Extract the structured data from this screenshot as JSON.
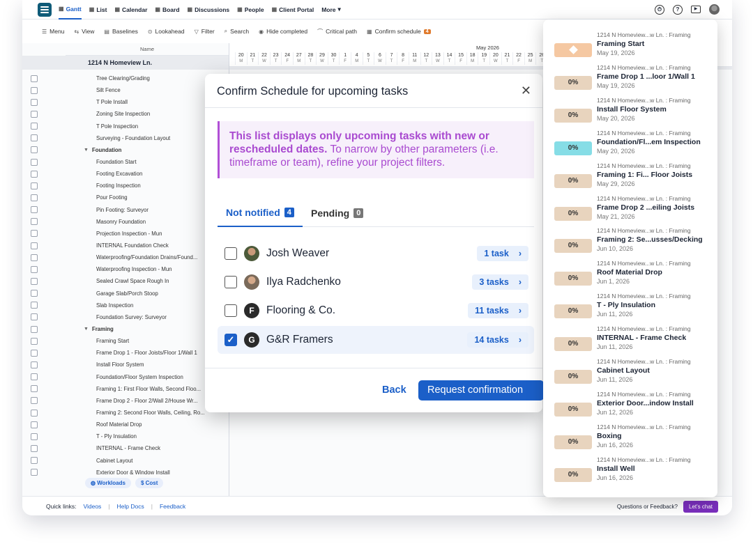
{
  "nav": {
    "items": [
      {
        "label": "Gantt",
        "icon": "gantt-icon",
        "active": true
      },
      {
        "label": "List",
        "icon": "list-icon"
      },
      {
        "label": "Calendar",
        "icon": "calendar-icon"
      },
      {
        "label": "Board",
        "icon": "board-icon"
      },
      {
        "label": "Discussions",
        "icon": "discussions-icon"
      },
      {
        "label": "People",
        "icon": "people-icon"
      },
      {
        "label": "Client Portal",
        "icon": "client-portal-icon"
      },
      {
        "label": "More"
      }
    ]
  },
  "toolbar": {
    "menu": "Menu",
    "view": "View",
    "baselines": "Baselines",
    "lookahead": "Lookahead",
    "filter": "Filter",
    "search": "Search",
    "hide_completed": "Hide completed",
    "critical_path": "Critical path",
    "confirm_schedule": "Confirm schedule",
    "confirm_count": "4"
  },
  "grid": {
    "name_header": "Name",
    "project": "1214 N Homeview Ln.",
    "rows": [
      {
        "label": "Tree Clearing/Grading"
      },
      {
        "label": "Silt Fence"
      },
      {
        "label": "T Pole Install"
      },
      {
        "label": "Zoning Site Inspection"
      },
      {
        "label": "T Pole Inspection"
      },
      {
        "label": "Surveying - Foundation Layout"
      },
      {
        "label": "Foundation",
        "group": true
      },
      {
        "label": "Foundation Start"
      },
      {
        "label": "Footing Excavation"
      },
      {
        "label": "Footing Inspection"
      },
      {
        "label": "Pour Footing"
      },
      {
        "label": "Pin Footing: Surveyor"
      },
      {
        "label": "Masonry Foundation"
      },
      {
        "label": "Projection Inspection - Mun"
      },
      {
        "label": "INTERNAL Foundation Check"
      },
      {
        "label": "Waterproofing/Foundation Drains/Found..."
      },
      {
        "label": "Waterproofing Inspection - Mun"
      },
      {
        "label": "Sealed Crawl Space Rough In"
      },
      {
        "label": "Garage Slab/Porch Stoop"
      },
      {
        "label": "Slab Inspection"
      },
      {
        "label": "Foundation Survey: Surveyor"
      },
      {
        "label": "Framing",
        "group": true
      },
      {
        "label": "Framing Start"
      },
      {
        "label": "Frame Drop 1 - Floor Joists/Floor 1/Wall 1"
      },
      {
        "label": "Install Floor System"
      },
      {
        "label": "Foundation/Floor System Inspection"
      },
      {
        "label": "Framing 1: First Floor Walls, Second Floo..."
      },
      {
        "label": "Frame Drop 2 - Floor 2/Wall 2/House Wr..."
      },
      {
        "label": "Framing 2: Second Floor Walls, Ceiling, Ro..."
      },
      {
        "label": "Roof Material Drop"
      },
      {
        "label": "T - Ply Insulation"
      },
      {
        "label": "INTERNAL - Frame Check"
      },
      {
        "label": "Cabinet Layout"
      },
      {
        "label": "Exterior Door & Window Install"
      }
    ]
  },
  "gantt": {
    "month": "May 2026",
    "days": [
      {
        "d": "20",
        "w": "M"
      },
      {
        "d": "21",
        "w": "T"
      },
      {
        "d": "22",
        "w": "W"
      },
      {
        "d": "23",
        "w": "T"
      },
      {
        "d": "24",
        "w": "F"
      },
      {
        "d": "27",
        "w": "M"
      },
      {
        "d": "28",
        "w": "T"
      },
      {
        "d": "29",
        "w": "W"
      },
      {
        "d": "30",
        "w": "T"
      },
      {
        "d": "1",
        "w": "F"
      },
      {
        "d": "4",
        "w": "M"
      },
      {
        "d": "5",
        "w": "T"
      },
      {
        "d": "6",
        "w": "W"
      },
      {
        "d": "7",
        "w": "T"
      },
      {
        "d": "8",
        "w": "F"
      },
      {
        "d": "11",
        "w": "M"
      },
      {
        "d": "12",
        "w": "T"
      },
      {
        "d": "13",
        "w": "W"
      },
      {
        "d": "14",
        "w": "T"
      },
      {
        "d": "15",
        "w": "F"
      },
      {
        "d": "18",
        "w": "M"
      },
      {
        "d": "19",
        "w": "T"
      },
      {
        "d": "20",
        "w": "W"
      },
      {
        "d": "21",
        "w": "T"
      },
      {
        "d": "22",
        "w": "F"
      },
      {
        "d": "25",
        "w": "M"
      },
      {
        "d": "26",
        "w": "T"
      }
    ]
  },
  "subtabs": {
    "workloads": "Workloads",
    "cost": "Cost"
  },
  "footer": {
    "quick_links": "Quick links:",
    "videos": "Videos",
    "help_docs": "Help Docs",
    "feedback": "Feedback",
    "questions": "Questions or Feedback?",
    "chat": "Let's chat"
  },
  "modal": {
    "title": "Confirm Schedule for upcoming tasks",
    "notice_bold": "This list displays only upcoming tasks with new or rescheduled dates.",
    "notice_rest": " To narrow by other parameters (i.e. timeframe or team), refine your project filters.",
    "tab_not_notified": "Not notified",
    "not_notified_count": "4",
    "tab_pending": "Pending",
    "pending_count": "0",
    "rows": [
      {
        "name": "Josh Weaver",
        "tasks": "1 task",
        "checked": false
      },
      {
        "name": "Ilya Radchenko",
        "tasks": "3 tasks",
        "checked": false
      },
      {
        "name": "Flooring & Co.",
        "tasks": "11 tasks",
        "checked": false,
        "letter": "F"
      },
      {
        "name": "G&R Framers",
        "tasks": "14 tasks",
        "checked": true,
        "letter": "G"
      }
    ],
    "back": "Back",
    "request": "Request confirmation"
  },
  "panel": {
    "items": [
      {
        "project": "1214 N Homeview...w Ln. : Framing",
        "task": "Framing Start",
        "date": "May 19, 2026",
        "badge": "",
        "color": "orange"
      },
      {
        "project": "1214 N Homeview...w Ln. : Framing",
        "task": "Frame Drop 1 ...loor 1/Wall 1",
        "date": "May 19, 2026",
        "badge": "0%",
        "color": "tan"
      },
      {
        "project": "1214 N Homeview...w Ln. : Framing",
        "task": "Install Floor System",
        "date": "May 20, 2026",
        "badge": "0%",
        "color": "tan"
      },
      {
        "project": "1214 N Homeview...w Ln. : Framing",
        "task": "Foundation/Fl...em Inspection",
        "date": "May 20, 2026",
        "badge": "0%",
        "color": "teal"
      },
      {
        "project": "1214 N Homeview...w Ln. : Framing",
        "task": "Framing 1: Fi... Floor Joists",
        "date": "May 29, 2026",
        "badge": "0%",
        "color": "tan"
      },
      {
        "project": "1214 N Homeview...w Ln. : Framing",
        "task": "Frame Drop 2 ...eiling Joists",
        "date": "May 21, 2026",
        "badge": "0%",
        "color": "tan"
      },
      {
        "project": "1214 N Homeview...w Ln. : Framing",
        "task": "Framing 2: Se...usses/Decking",
        "date": "Jun 10, 2026",
        "badge": "0%",
        "color": "tan"
      },
      {
        "project": "1214 N Homeview...w Ln. : Framing",
        "task": "Roof Material Drop",
        "date": "Jun 1, 2026",
        "badge": "0%",
        "color": "tan"
      },
      {
        "project": "1214 N Homeview...w Ln. : Framing",
        "task": "T - Ply Insulation",
        "date": "Jun 11, 2026",
        "badge": "0%",
        "color": "tan"
      },
      {
        "project": "1214 N Homeview...w Ln. : Framing",
        "task": "INTERNAL - Frame Check",
        "date": "Jun 11, 2026",
        "badge": "0%",
        "color": "tan"
      },
      {
        "project": "1214 N Homeview...w Ln. : Framing",
        "task": "Cabinet Layout",
        "date": "Jun 11, 2026",
        "badge": "0%",
        "color": "tan"
      },
      {
        "project": "1214 N Homeview...w Ln. : Framing",
        "task": "Exterior Door...indow Install",
        "date": "Jun 12, 2026",
        "badge": "0%",
        "color": "tan"
      },
      {
        "project": "1214 N Homeview...w Ln. : Framing",
        "task": "Boxing",
        "date": "Jun 16, 2026",
        "badge": "0%",
        "color": "tan"
      },
      {
        "project": "1214 N Homeview...w Ln. : Framing",
        "task": "Install Well",
        "date": "Jun 16, 2026",
        "badge": "0%",
        "color": "tan"
      }
    ]
  }
}
